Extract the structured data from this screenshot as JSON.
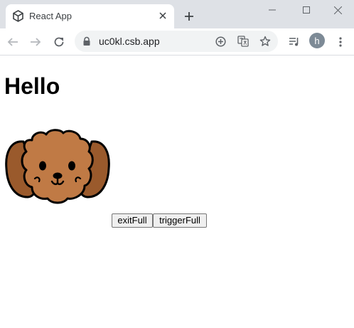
{
  "browser": {
    "tab": {
      "title": "React App"
    },
    "address_bar": {
      "url": "uc0kl.csb.app"
    },
    "profile": {
      "initial": "h"
    }
  },
  "page": {
    "heading": "Hello",
    "buttons": {
      "exit_full": "exitFull",
      "trigger_full": "triggerFull"
    }
  },
  "colors": {
    "tabstrip_bg": "#dee1e6",
    "dog_fur": "#c07a45",
    "dog_ears": "#9a5a2c"
  }
}
